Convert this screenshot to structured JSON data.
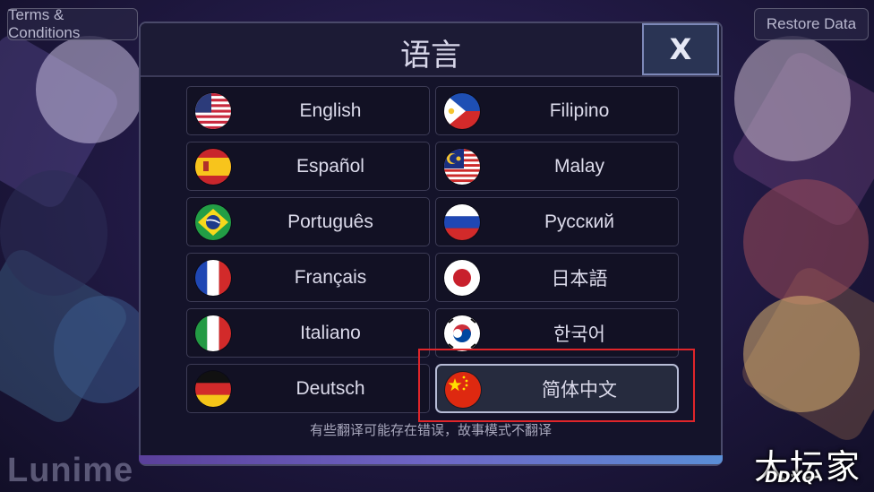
{
  "header_buttons": {
    "terms": "Terms & Conditions",
    "restore": "Restore Data"
  },
  "brand": "Lunime",
  "watermark": {
    "main": "大坛家",
    "sub": "DDXQ"
  },
  "dialog": {
    "title": "语言",
    "close_label": "X",
    "note": "有些翻译可能存在错误，故事模式不翻译"
  },
  "languages": [
    {
      "label": "English",
      "flag": "us-flag-icon"
    },
    {
      "label": "Filipino",
      "flag": "ph-flag-icon"
    },
    {
      "label": "Español",
      "flag": "es-flag-icon"
    },
    {
      "label": "Malay",
      "flag": "my-flag-icon"
    },
    {
      "label": "Português",
      "flag": "br-flag-icon"
    },
    {
      "label": "Русский",
      "flag": "ru-flag-icon"
    },
    {
      "label": "Français",
      "flag": "fr-flag-icon"
    },
    {
      "label": "日本語",
      "flag": "jp-flag-icon"
    },
    {
      "label": "Italiano",
      "flag": "it-flag-icon"
    },
    {
      "label": "한국어",
      "flag": "kr-flag-icon"
    },
    {
      "label": "Deutsch",
      "flag": "de-flag-icon"
    },
    {
      "label": "简体中文",
      "flag": "cn-flag-icon",
      "selected": true
    }
  ],
  "colors": {
    "highlight": "#e0252a",
    "dialog_bg": "#14132a",
    "close_button": "#2a3454"
  }
}
